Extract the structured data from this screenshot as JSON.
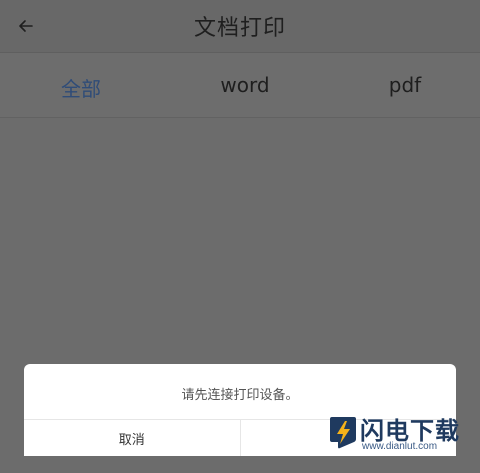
{
  "header": {
    "title": "文档打印",
    "back_icon": "arrow-left-icon"
  },
  "tabs": [
    {
      "label": "全部",
      "active": true
    },
    {
      "label": "word",
      "active": false
    },
    {
      "label": "pdf",
      "active": false
    }
  ],
  "colors": {
    "overlay_bg": "#6c6c6c",
    "tab_active": "#2f4c78",
    "dialog_bg": "#ffffff"
  },
  "dialog": {
    "message": "请先连接打印设备。",
    "cancel_label": "取消",
    "confirm_label": ""
  },
  "watermark": {
    "title": "闪电下载",
    "url": "www.dianlut.com",
    "logo_icon": "lightning-bolt-icon"
  }
}
